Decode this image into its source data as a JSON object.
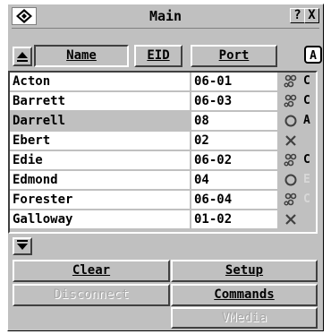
{
  "window": {
    "title": "Main"
  },
  "title_buttons": {
    "help": "?",
    "close": "X"
  },
  "sort": {
    "name": "Name",
    "eid": "EID",
    "port": "Port"
  },
  "servers": [
    {
      "name": "Acton",
      "port": "06-01",
      "status_icon": "users-icon",
      "letter": "C"
    },
    {
      "name": "Barrett",
      "port": "06-03",
      "status_icon": "users-icon",
      "letter": "C"
    },
    {
      "name": "Darrell",
      "port": "08",
      "status_icon": "circle-icon",
      "letter": "A"
    },
    {
      "name": "Ebert",
      "port": "02",
      "status_icon": "x-icon",
      "letter": ""
    },
    {
      "name": "Edie",
      "port": "06-02",
      "status_icon": "users-icon",
      "letter": "C"
    },
    {
      "name": "Edmond",
      "port": "04",
      "status_icon": "circle-icon",
      "letter": "E"
    },
    {
      "name": "Forester",
      "port": "06-04",
      "status_icon": "users-icon",
      "letter": "C"
    },
    {
      "name": "Galloway",
      "port": "01-02",
      "status_icon": "x-icon",
      "letter": ""
    }
  ],
  "buttons": {
    "clear": "Clear",
    "setup": "Setup",
    "disconnect": "Disconnect",
    "commands": "Commands",
    "vmedia": "VMedia"
  },
  "colors": {
    "panel": "#c0c0c0",
    "cell": "#ffffff",
    "icon": "#404040"
  }
}
